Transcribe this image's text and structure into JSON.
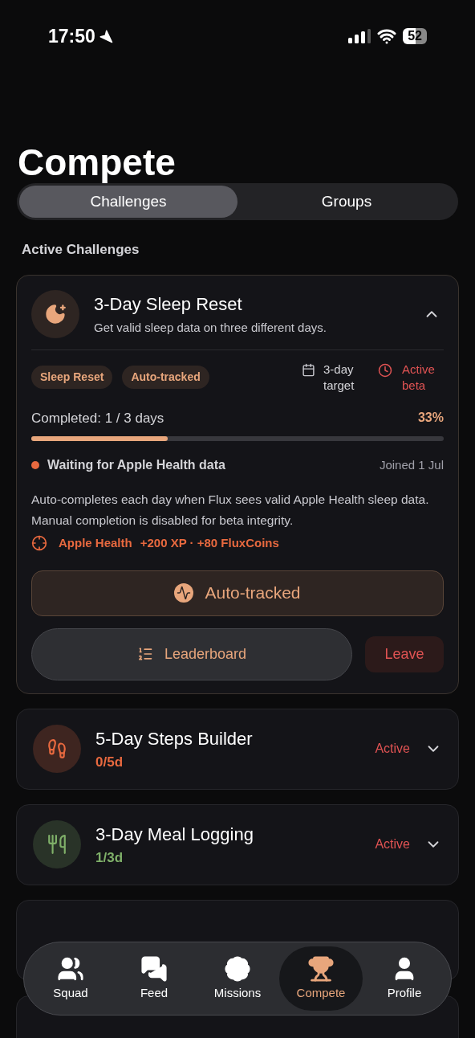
{
  "status_bar": {
    "time": "17:50",
    "battery": "52"
  },
  "title": "Compete",
  "tabs": [
    {
      "label": "Challenges",
      "selected": true
    },
    {
      "label": "Groups",
      "selected": false
    }
  ],
  "section_title": "Active Challenges",
  "featured": {
    "title": "3-Day Sleep Reset",
    "subtitle": "Get valid sleep data on three different days.",
    "expanded": true,
    "tags": [
      "Sleep Reset",
      "Auto-tracked"
    ],
    "target": "3-day target",
    "status": "Active beta",
    "progress_label": "Completed: 1 / 3 days",
    "percent": "33%",
    "level": 0.33,
    "waiting": "Waiting for Apple Health data",
    "joined": "Joined 1 Jul",
    "description": "Auto-completes each day when Flux sees valid Apple Health sleep data. Manual completion is disabled for beta integrity.",
    "source": "Apple Health",
    "reward": "+200 XP · +80 FluxCoins",
    "primary_button": "Auto-tracked",
    "leaderboard_button": "Leaderboard",
    "leave_button": "Leave"
  },
  "challenges": [
    {
      "kind": "steps",
      "title": "5-Day Steps Builder",
      "progress": "0/5d",
      "status": "Active",
      "color": "#e8693f",
      "expanded": false
    },
    {
      "kind": "meal",
      "title": "3-Day Meal Logging",
      "progress": "1/3d",
      "status": "Active",
      "color": "#7fb069",
      "expanded": false
    }
  ],
  "nav": [
    {
      "kind": "squad",
      "label": "Squad",
      "selected": false
    },
    {
      "kind": "feed",
      "label": "Feed",
      "selected": false
    },
    {
      "kind": "missions",
      "label": "Missions",
      "selected": false
    },
    {
      "kind": "compete",
      "label": "Compete",
      "selected": true
    },
    {
      "kind": "profile",
      "label": "Profile",
      "selected": false
    }
  ]
}
